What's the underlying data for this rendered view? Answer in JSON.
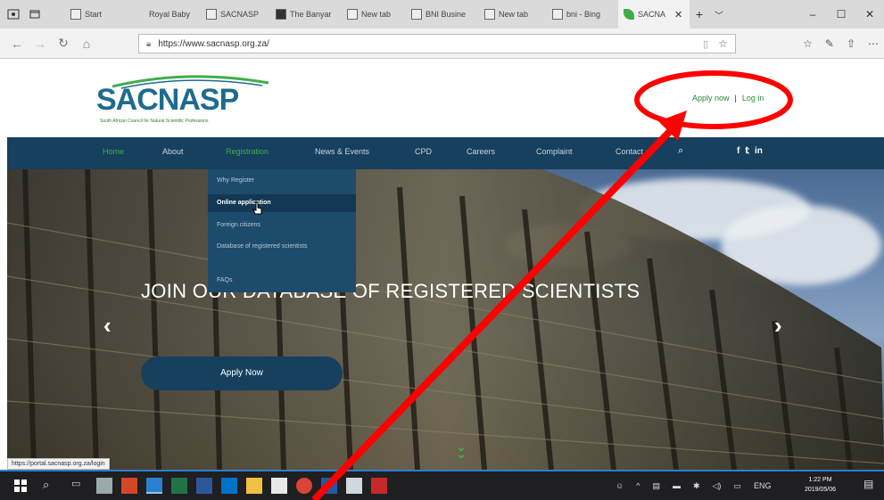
{
  "browser": {
    "tabs": [
      {
        "label": "Start"
      },
      {
        "label": "Royal Baby"
      },
      {
        "label": "SACNASP"
      },
      {
        "label": "The Banyar"
      },
      {
        "label": "New tab"
      },
      {
        "label": "BNI Busine"
      },
      {
        "label": "New tab"
      },
      {
        "label": "bni - Bing"
      },
      {
        "label": "SACNA"
      }
    ],
    "address": "https://www.sacnasp.org.za/",
    "window_controls": {
      "minimize": "–",
      "maximize": "☐",
      "close": "✕"
    }
  },
  "site": {
    "logo_text": "SACNASP",
    "logo_tagline": "South African Council for Natural Scientific Professions",
    "account": {
      "apply": "Apply now",
      "sep": "|",
      "login": "Log in"
    },
    "nav": [
      "Home",
      "About",
      "Registration",
      "News & Events",
      "CPD",
      "Careers",
      "Complaint",
      "Contact"
    ],
    "social": [
      "f",
      "𝕥",
      "in"
    ],
    "dropdown": [
      "Why Register",
      "Online application",
      "Foreign citizens",
      "Database of registered scientists",
      "FAQs"
    ],
    "hero": {
      "title": "JOIN OUR DATABASE OF REGISTERED SCIENTISTS",
      "button": "Apply Now"
    }
  },
  "status_url": "https://portal.sacnasp.org.za/login",
  "taskbar": {
    "time": "1:22 PM",
    "date": "2019/05/06",
    "lang": "ENG"
  },
  "colors": {
    "brand_blue": "#16405e",
    "brand_green": "#3fae4a",
    "annotation_red": "#ff0000"
  }
}
